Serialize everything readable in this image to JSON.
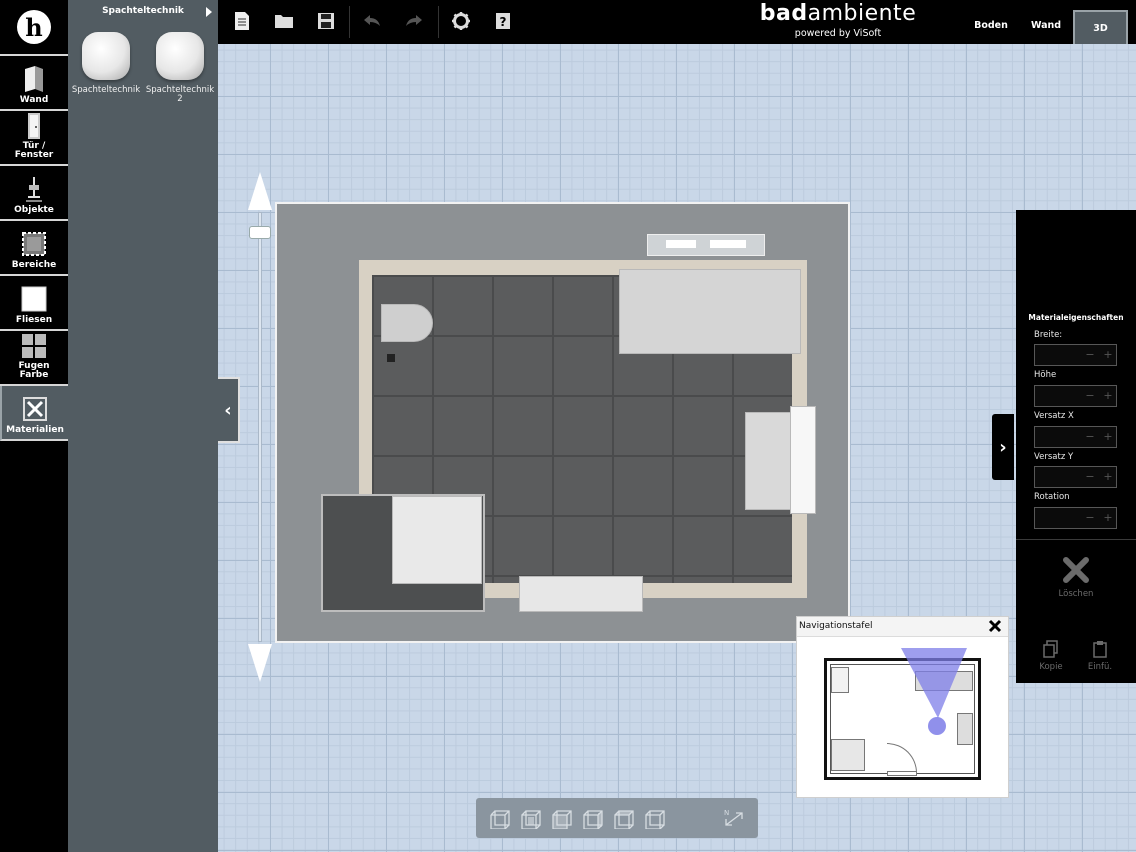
{
  "left_bar": {
    "logo_letter": "h",
    "tools": [
      {
        "label": "Wand",
        "icon": "wall-icon"
      },
      {
        "label": "Tür /\nFenster",
        "icon": "door-icon"
      },
      {
        "label": "Objekte",
        "icon": "faucet-icon"
      },
      {
        "label": "Bereiche",
        "icon": "area-icon"
      },
      {
        "label": "Fliesen",
        "icon": "tile-icon"
      },
      {
        "label": "Fugen\nFarbe",
        "icon": "grout-icon"
      },
      {
        "label": "Materialien",
        "icon": "materials-icon"
      }
    ],
    "active_tool": "Materialien"
  },
  "catalog": {
    "header": "Spachteltechnik",
    "items": [
      {
        "label": "Spachteltechnik"
      },
      {
        "label": "Spachteltechnik 2"
      }
    ]
  },
  "toolbar": {
    "buttons": [
      "new-file-icon",
      "open-folder-icon",
      "save-icon",
      "undo-icon",
      "redo-icon",
      "settings-icon",
      "help-icon"
    ]
  },
  "brand": {
    "name_bold": "bad",
    "name_rest": "ambiente",
    "tagline": "powered by ViSoft"
  },
  "views": {
    "floor": "Boden",
    "wall": "Wand",
    "three_d": "3D",
    "active": "3D"
  },
  "props": {
    "title": "Materialeigenschaften",
    "fields": [
      {
        "label": "Breite:"
      },
      {
        "label": "Höhe"
      },
      {
        "label": "Versatz X"
      },
      {
        "label": "Versatz Y"
      },
      {
        "label": "Rotation"
      }
    ],
    "delete_label": "Löschen",
    "copy_label": "Kopie",
    "paste_label": "Einfü."
  },
  "nav": {
    "title": "Navigationstafel"
  },
  "colors": {
    "panel": "#525c62",
    "bar": "#000000",
    "grid": "#c9d7e8",
    "nav_cone": "#7d7de8"
  }
}
